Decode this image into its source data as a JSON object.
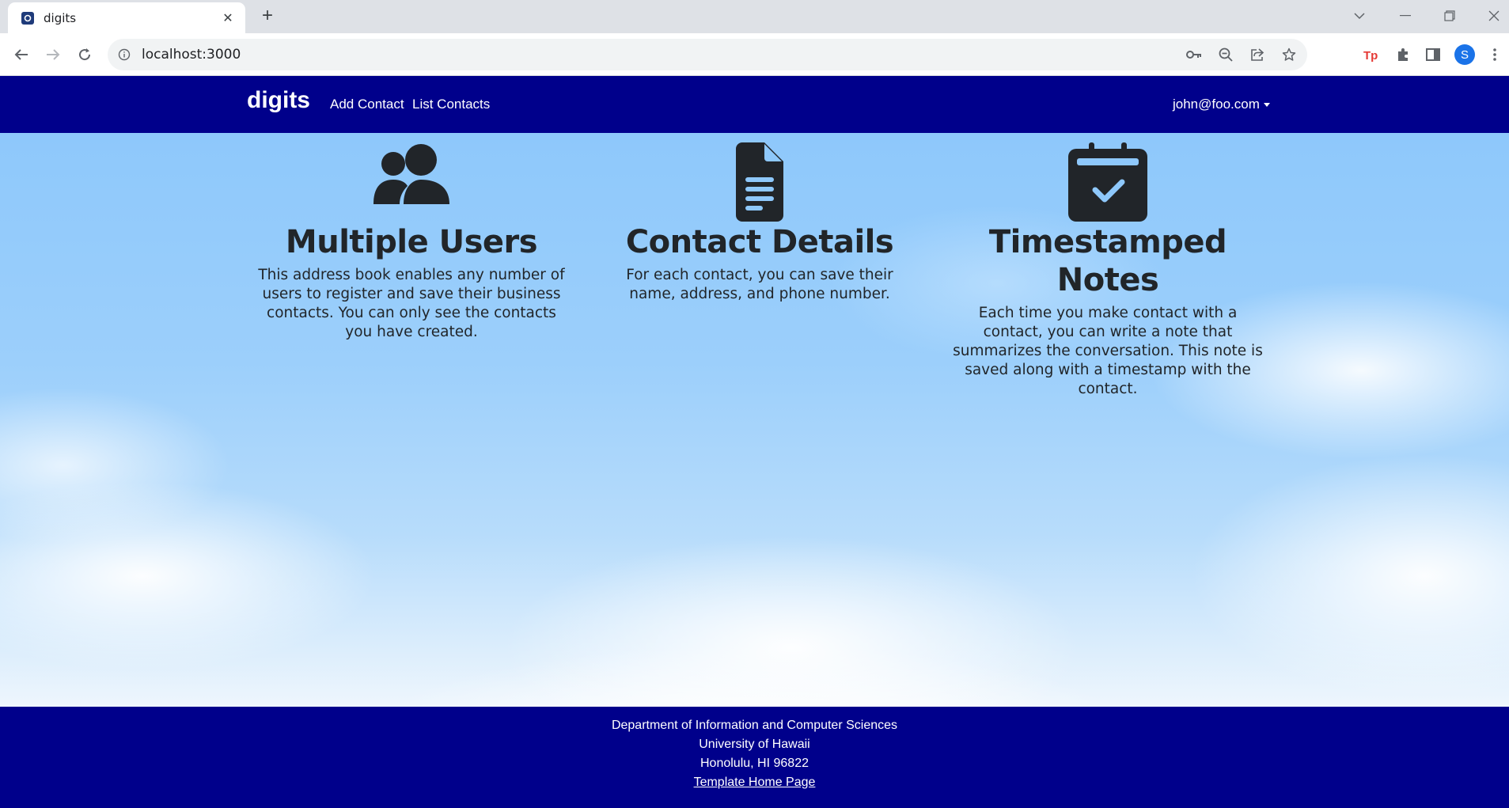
{
  "browser": {
    "tab_title": "digits",
    "url": "localhost:3000",
    "profile_initial": "S"
  },
  "navbar": {
    "brand": "digits",
    "links": [
      "Add Contact",
      "List Contacts"
    ],
    "user": "john@foo.com"
  },
  "features": [
    {
      "icon": "users-icon",
      "title": "Multiple Users",
      "text": "This address book enables any number of users to register and save their business contacts. You can only see the contacts you have created."
    },
    {
      "icon": "file-icon",
      "title": "Contact Details",
      "text": "For each contact, you can save their name, address, and phone number."
    },
    {
      "icon": "calendar-check-icon",
      "title": "Timestamped Notes",
      "text": "Each time you make contact with a contact, you can write a note that summarizes the conversation. This note is saved along with a timestamp with the contact."
    }
  ],
  "footer": {
    "line1": "Department of Information and Computer Sciences",
    "line2": "University of Hawaii",
    "line3": "Honolulu, HI 96822",
    "link": "Template Home Page"
  },
  "colors": {
    "navbar_bg": "#00008b",
    "text_dark": "#212529",
    "sky": "#8ec8fb"
  }
}
